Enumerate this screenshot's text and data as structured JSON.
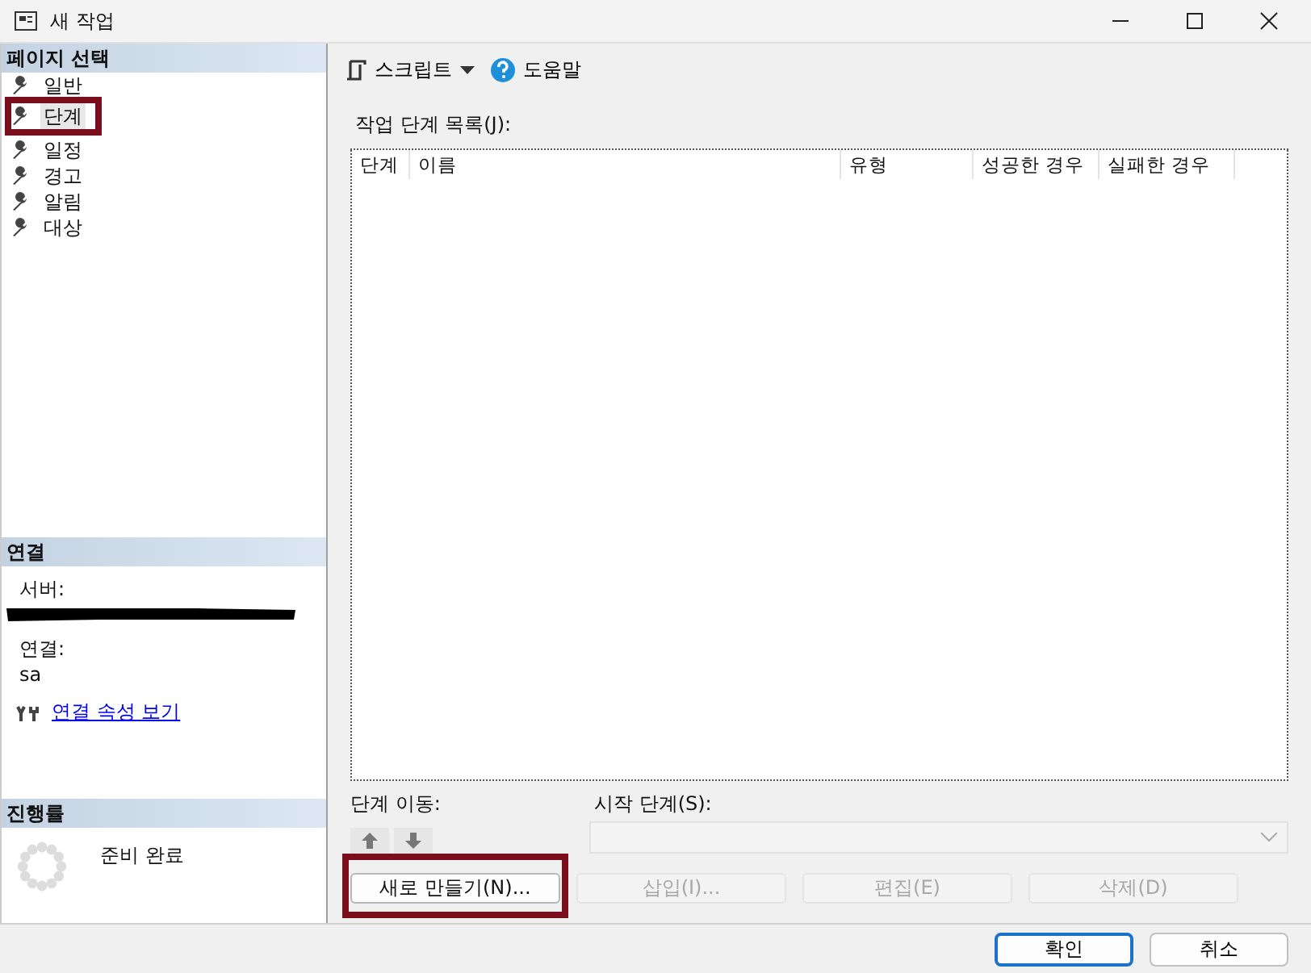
{
  "window": {
    "title": "새 작업"
  },
  "page_select": {
    "header": "페이지 선택",
    "items": [
      {
        "label": "일반",
        "selected": false,
        "highlighted": false
      },
      {
        "label": "단계",
        "selected": true,
        "highlighted": true
      },
      {
        "label": "일정",
        "selected": false,
        "highlighted": false
      },
      {
        "label": "경고",
        "selected": false,
        "highlighted": false
      },
      {
        "label": "알림",
        "selected": false,
        "highlighted": false
      },
      {
        "label": "대상",
        "selected": false,
        "highlighted": false
      }
    ]
  },
  "connection": {
    "header": "연결",
    "server_label": "서버:",
    "server_redacted": true,
    "connection_label": "연결:",
    "connection_value": "sa",
    "link": "연결 속성 보기"
  },
  "progress": {
    "header": "진행률",
    "status": "준비 완료"
  },
  "toolbar": {
    "script": "스크립트",
    "help": "도움말"
  },
  "steps": {
    "label": "작업 단계 목록(J):",
    "columns": [
      "단계",
      "이름",
      "유형",
      "성공한 경우",
      "실패한 경우"
    ]
  },
  "move_label": "단계 이동:",
  "start_step": {
    "label": "시작 단계(S):",
    "disabled": true
  },
  "buttons": [
    {
      "label": "새로 만들기(N)...",
      "disabled": false,
      "highlighted": true
    },
    {
      "label": "삽입(I)...",
      "disabled": true,
      "highlighted": false
    },
    {
      "label": "편집(E)",
      "disabled": true,
      "highlighted": false
    },
    {
      "label": "삭제(D)",
      "disabled": true,
      "highlighted": false
    }
  ],
  "footer": {
    "ok": "확인",
    "cancel": "취소"
  }
}
